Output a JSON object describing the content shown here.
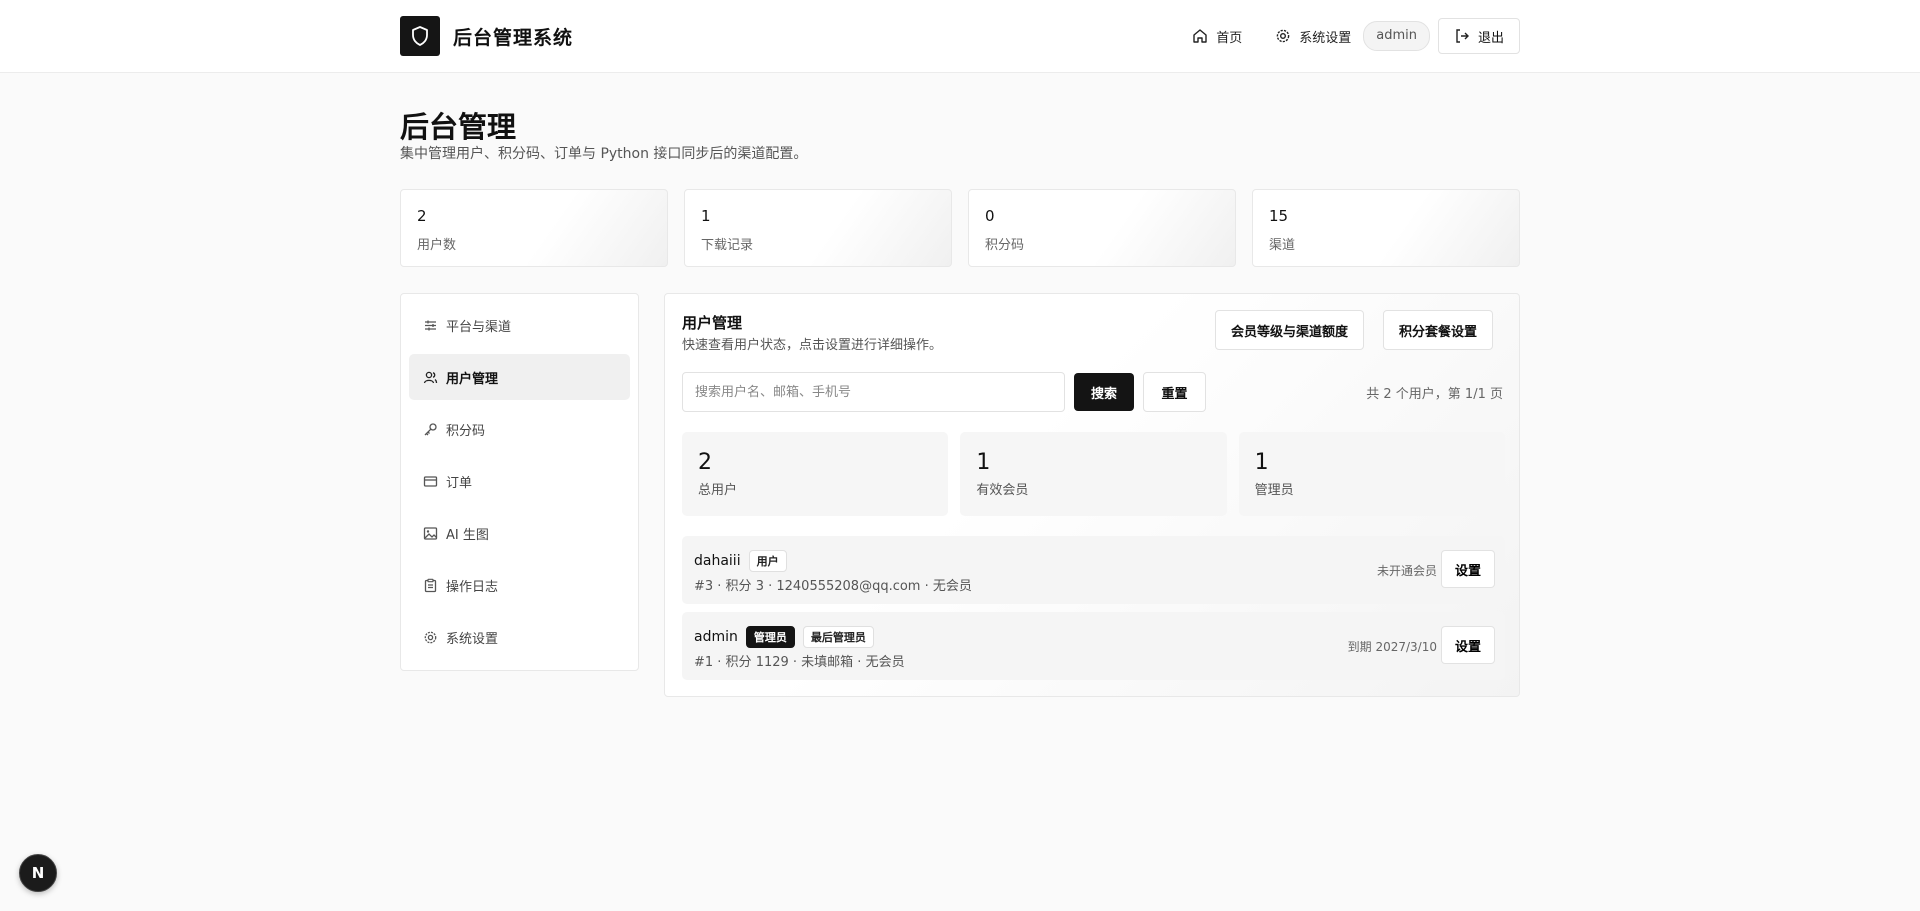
{
  "header": {
    "app_title": "后台管理系统",
    "nav_home": "首页",
    "nav_settings": "系统设置",
    "user": "admin",
    "logout": "退出"
  },
  "page": {
    "title": "后台管理",
    "subtitle": "集中管理用户、积分码、订单与 Python 接口同步后的渠道配置。"
  },
  "stats": [
    {
      "value": "2",
      "label": "用户数"
    },
    {
      "value": "1",
      "label": "下载记录"
    },
    {
      "value": "0",
      "label": "积分码"
    },
    {
      "value": "15",
      "label": "渠道"
    }
  ],
  "sidebar": {
    "items": [
      {
        "label": "平台与渠道",
        "icon": "sliders-icon"
      },
      {
        "label": "用户管理",
        "icon": "users-icon",
        "active": true
      },
      {
        "label": "积分码",
        "icon": "key-icon"
      },
      {
        "label": "订单",
        "icon": "credit-card-icon"
      },
      {
        "label": "AI 生图",
        "icon": "image-icon"
      },
      {
        "label": "操作日志",
        "icon": "clipboard-icon"
      },
      {
        "label": "系统设置",
        "icon": "gear-icon"
      }
    ]
  },
  "panel": {
    "title": "用户管理",
    "description": "快速查看用户状态，点击设置进行详细操作。",
    "tier_button": "会员等级与渠道额度",
    "points_button": "积分套餐设置",
    "search_placeholder": "搜索用户名、邮箱、手机号",
    "search_button": "搜索",
    "reset_button": "重置",
    "pagination": "共 2 个用户，第 1/1 页",
    "summary": [
      {
        "value": "2",
        "label": "总用户"
      },
      {
        "value": "1",
        "label": "有效会员"
      },
      {
        "value": "1",
        "label": "管理员"
      }
    ],
    "users": [
      {
        "name": "dahaiii",
        "badges": [
          "用户"
        ],
        "meta": "#3 · 积分 3 · 1240555208@qq.com · 无会员",
        "status": "未开通会员",
        "action": "设置"
      },
      {
        "name": "admin",
        "badges": [
          "管理员",
          "最后管理员"
        ],
        "meta": "#1 · 积分 1129 · 未填邮箱 · 无会员",
        "status": "到期 2027/3/10",
        "action": "设置"
      }
    ]
  },
  "dev_badge": "N"
}
